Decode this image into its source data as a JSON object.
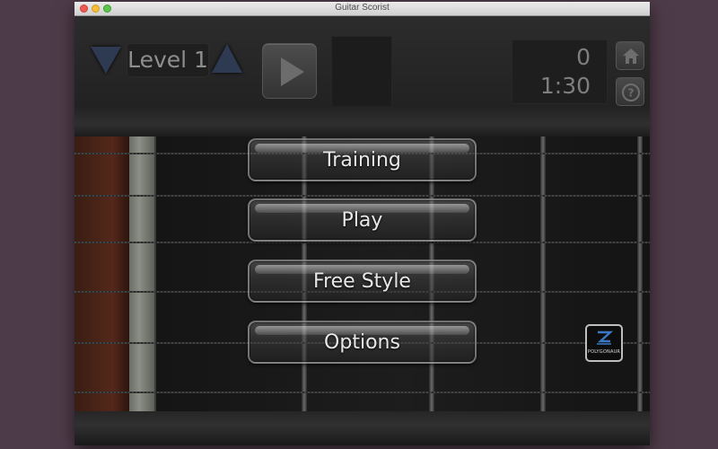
{
  "window": {
    "title": "Guitar Scorist"
  },
  "header": {
    "level_label": "Level 1",
    "score": "0",
    "time": "1:30",
    "icons": {
      "level_down": "triangle-down-icon",
      "level_up": "triangle-up-icon",
      "play": "play-icon",
      "home": "home-icon",
      "help": "question-icon"
    }
  },
  "menu": {
    "items": [
      {
        "label": "Training"
      },
      {
        "label": "Play"
      },
      {
        "label": "Free Style"
      },
      {
        "label": "Options"
      }
    ]
  },
  "logo": {
    "text": "POLYGONAUR",
    "icon": "polygonaur-logo"
  },
  "colors": {
    "desktop": "#4e3b49",
    "accent_triangle": "#2d3a52",
    "button_text": "#e8e8e8"
  }
}
